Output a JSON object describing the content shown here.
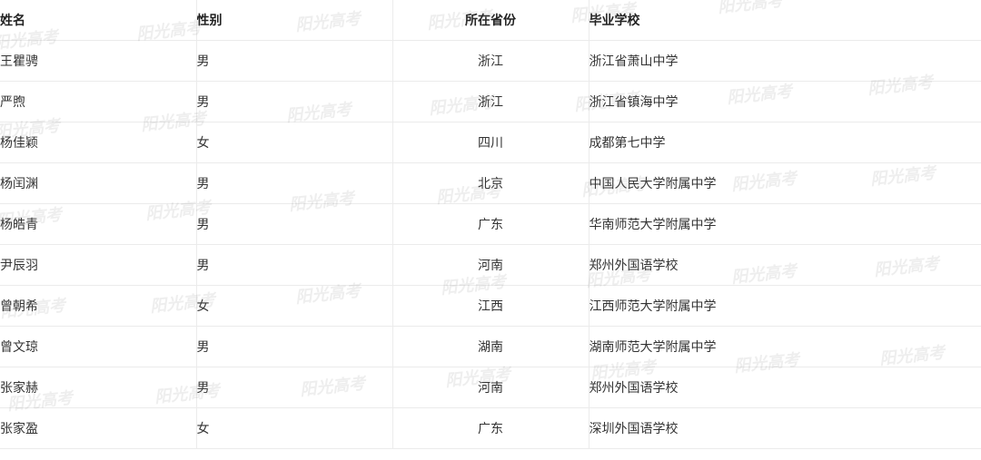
{
  "table": {
    "headers": [
      "姓名",
      "性别",
      "所在省份",
      "毕业学校"
    ],
    "rows": [
      [
        "王瞿骋",
        "男",
        "浙江",
        "浙江省萧山中学"
      ],
      [
        "严煦",
        "男",
        "浙江",
        "浙江省镇海中学"
      ],
      [
        "杨佳颖",
        "女",
        "四川",
        "成都第七中学"
      ],
      [
        "杨闰渊",
        "男",
        "北京",
        "中国人民大学附属中学"
      ],
      [
        "杨皓青",
        "男",
        "广东",
        "华南师范大学附属中学"
      ],
      [
        "尹辰羽",
        "男",
        "河南",
        "郑州外国语学校"
      ],
      [
        "曾朝希",
        "女",
        "江西",
        "江西师范大学附属中学"
      ],
      [
        "曾文琼",
        "男",
        "湖南",
        "湖南师范大学附属中学"
      ],
      [
        "张家赫",
        "男",
        "河南",
        "郑州外国语学校"
      ],
      [
        "张家盈",
        "女",
        "广东",
        "深圳外国语学校"
      ]
    ]
  },
  "watermark": {
    "text": "阳光高考"
  }
}
